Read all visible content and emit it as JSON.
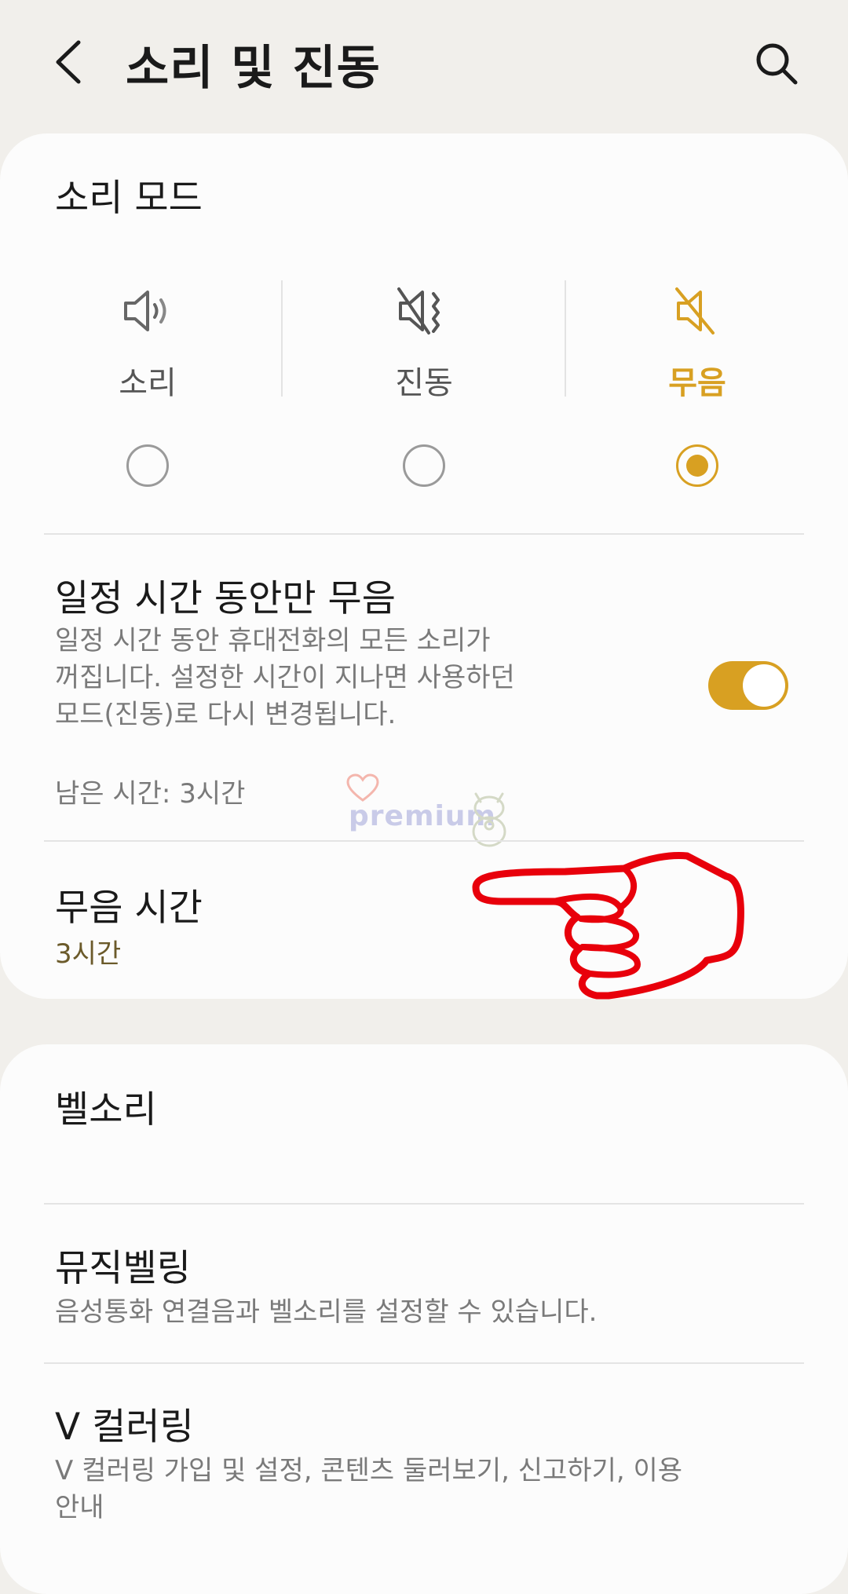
{
  "header": {
    "title": "소리 및 진동",
    "back_icon": "chevron-left-icon",
    "search_icon": "search-icon"
  },
  "sound_mode": {
    "heading": "소리 모드",
    "options": [
      {
        "label": "소리",
        "icon": "speaker-icon",
        "selected": false
      },
      {
        "label": "진동",
        "icon": "vibrate-icon",
        "selected": false
      },
      {
        "label": "무음",
        "icon": "mute-icon",
        "selected": true
      }
    ]
  },
  "temp_mute": {
    "title": "일정 시간 동안만 무음",
    "desc_lines": [
      "일정 시간 동안 휴대전화의 모든 소리가",
      "꺼집니다. 설정한 시간이 지나면 사용하던",
      "모드(진동)로 다시 변경됩니다."
    ],
    "toggle_on": true,
    "remaining": "남은 시간: 3시간"
  },
  "mute_duration": {
    "title": "무음 시간",
    "value": "3시간"
  },
  "ringtone": {
    "title": "벨소리"
  },
  "music_ring": {
    "title": "뮤직벨링",
    "desc": "음성통화 연결음과 벨소리를 설정할 수 있습니다."
  },
  "v_coloring": {
    "title": "V 컬러링",
    "desc_lines": [
      "V 컬러링 가입 및 설정, 콘텐츠 둘러보기, 신고하기, 이용",
      "안내"
    ]
  },
  "watermark": {
    "text": "premium"
  },
  "colors": {
    "accent": "#d8a022",
    "background": "#f1efeb",
    "card": "#fcfcfc",
    "annotation": "#e8000b"
  }
}
